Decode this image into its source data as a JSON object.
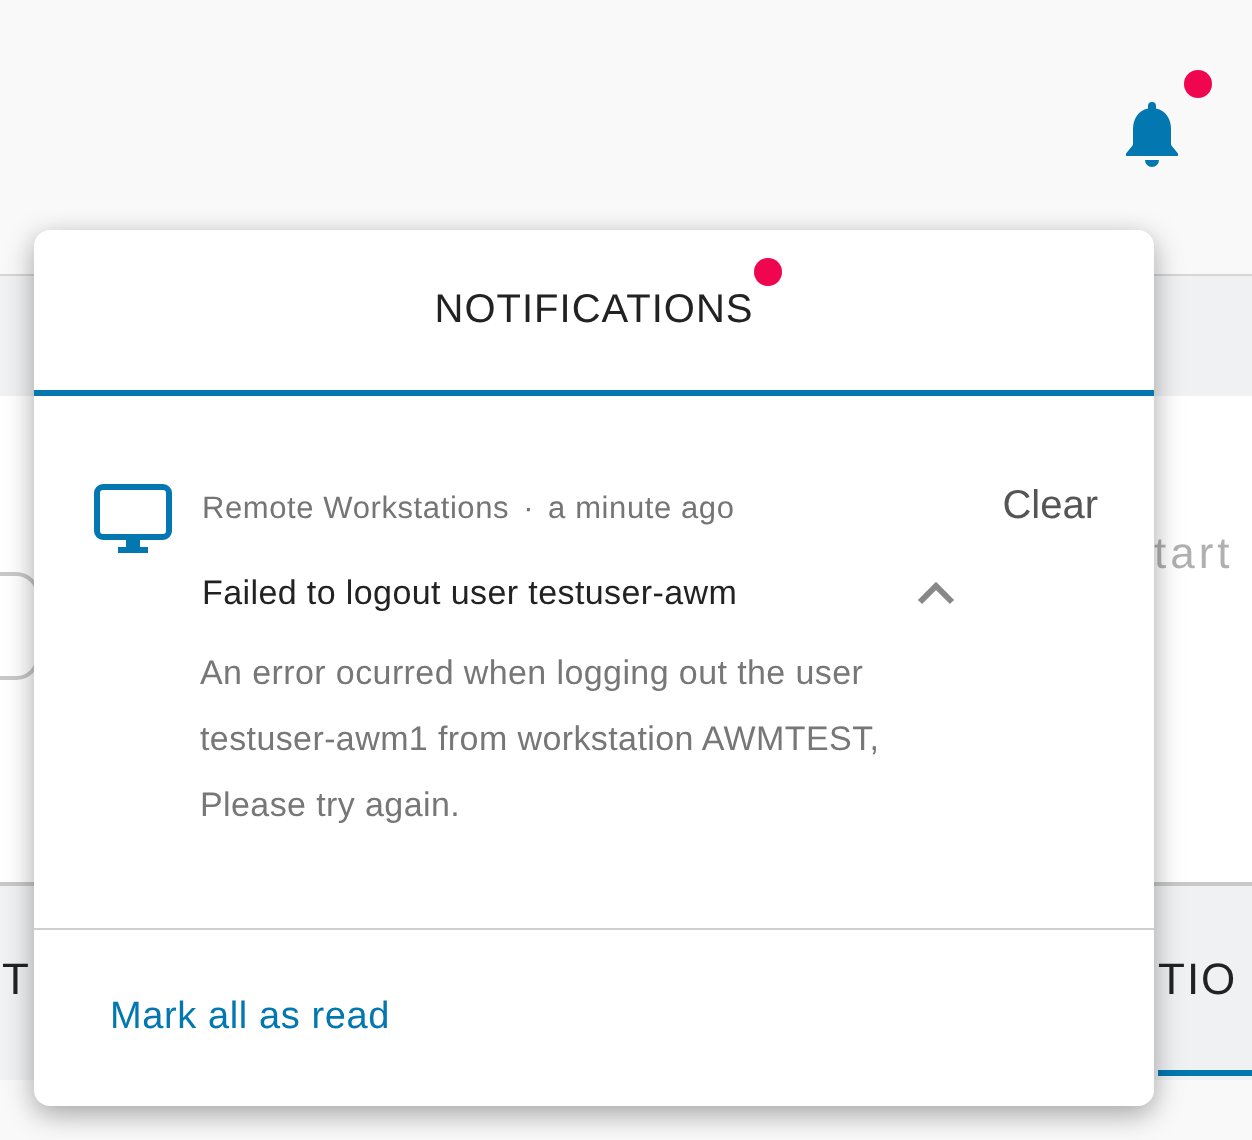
{
  "header": {
    "bell": {
      "badge": true
    }
  },
  "background": {
    "faded_text": "tart",
    "tabs": [
      {
        "label": "T",
        "selected": false
      },
      {
        "label": "TIO",
        "selected": true
      }
    ]
  },
  "notifications_panel": {
    "title": "NOTIFICATIONS",
    "unread": true,
    "items": [
      {
        "source": "Remote Workstations",
        "separator": "·",
        "time": "a minute ago",
        "clear": "Clear",
        "title": "Failed to logout user testuser-awm",
        "expanded": true,
        "description": "An error ocurred when logging out the user testuser-awm1 from workstation AWMTEST, Please try again."
      }
    ],
    "footer": "Mark all as read"
  }
}
